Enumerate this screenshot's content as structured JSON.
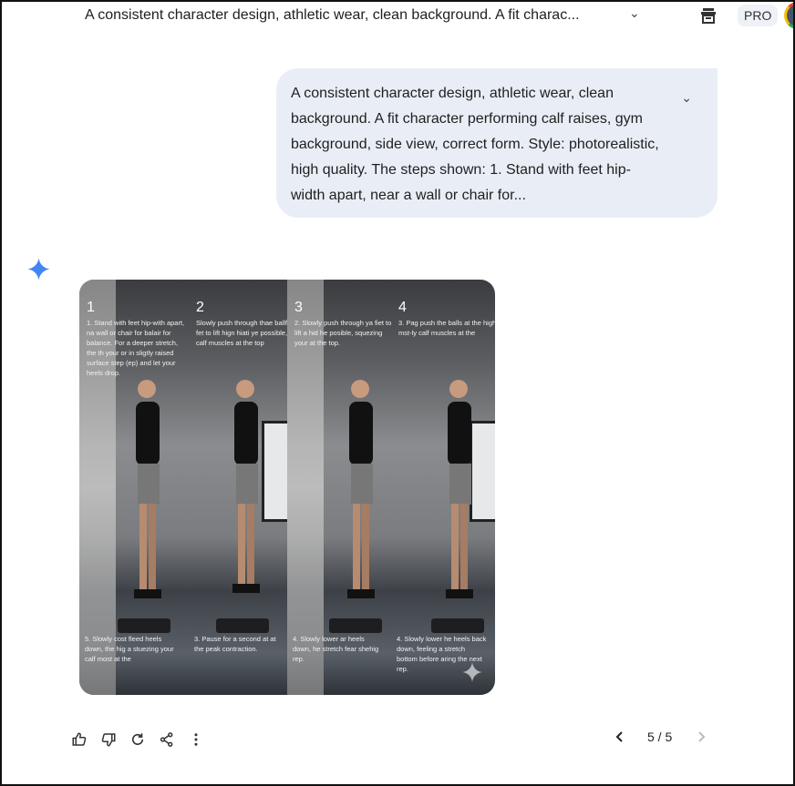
{
  "header": {
    "title": "A consistent character design, athletic wear, clean background.  A fit charac...",
    "badge": "PRO"
  },
  "prompt": {
    "text": "A consistent character design, athletic wear, clean background.  A fit character performing calf raises, gym background, side view, correct form. Style: photorealistic, high quality.  The steps shown: 1. Stand with feet hip-width apart, near a wall or chair for..."
  },
  "image": {
    "panels": [
      {
        "num": "1",
        "top": "1. Stand with feet hip-with apart, na wall or chair for balair for balance. For a deeper stretch, the th your or in sligtly raised surface step (ep) and let your heels drop.",
        "bottom": "5. Slowly cost fleed heels down, the hig a stuezing your calf most at the"
      },
      {
        "num": "2",
        "top": "Slowly push through thae ballfor fet to lift hign hiati ye possible, ya calf muscles at the top",
        "bottom": "3. Pause for a second at at the peak contraction."
      },
      {
        "num": "3",
        "top": "2. Slowly push through ya fiet to lift a hid he posible, squezing your at the top.",
        "bottom": "4. Slowly lower ar heels down, he stretch fear shehig rep."
      },
      {
        "num": "4",
        "top": "3.  Pag push the balls at the high mst-ly calf muscles at the",
        "bottom": "4. Slowly lower he heels back down, feeling a stretch bottom before aring the next rep."
      }
    ]
  },
  "pager": {
    "current": "5 / 5"
  },
  "colors": {
    "bubble": "#e9eef6",
    "accent": "#4285f4"
  }
}
